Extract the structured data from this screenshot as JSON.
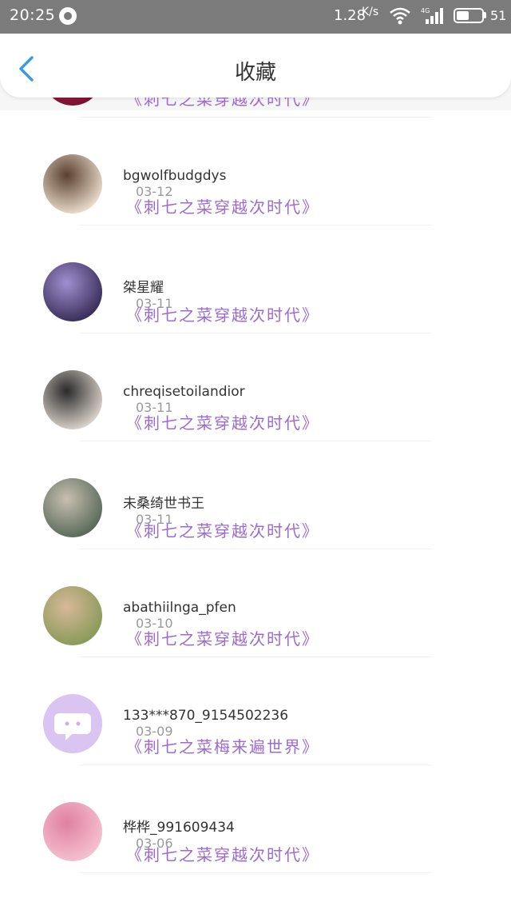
{
  "status_bar": {
    "time": "20:25",
    "speed": "1.28",
    "speed_unit": "K/s",
    "network": "4G",
    "battery": "51",
    "battery_level": 0.51
  },
  "header": {
    "title": "收藏"
  },
  "items": [
    {
      "username": "",
      "date": "",
      "book": "《刺七之菜穿越次时代》",
      "avatar_colors": [
        "#7a1030",
        "#c03060"
      ]
    },
    {
      "username": "bgwolfbudgdys",
      "date": "03-12",
      "book": "《刺七之菜穿越次时代》",
      "avatar_colors": [
        "#e8d9c8",
        "#5a4030"
      ]
    },
    {
      "username": "桀星耀",
      "date": "03-11",
      "book": "《刺七之菜穿越次时代》",
      "avatar_colors": [
        "#3a2e5a",
        "#a090d0"
      ]
    },
    {
      "username": "chreqisetoilandior",
      "date": "03-11",
      "book": "《刺七之菜穿越次时代》",
      "avatar_colors": [
        "#d8d0c8",
        "#2a2a2a"
      ]
    },
    {
      "username": "未桑绮世书王",
      "date": "03-11",
      "book": "《刺七之菜穿越次时代》",
      "avatar_colors": [
        "#5a6a5a",
        "#c8c0b0"
      ]
    },
    {
      "username": "abathiilnga_pfen",
      "date": "03-10",
      "book": "《刺七之菜穿越次时代》",
      "avatar_colors": [
        "#8a9a5a",
        "#d8b898"
      ]
    },
    {
      "username": "133***870_9154502236",
      "date": "03-09",
      "book": "《刺七之菜梅来遍世界》",
      "avatar_colors": [
        "#d9c4f2",
        "#ffffff"
      ]
    },
    {
      "username": "桦桦_991609434",
      "date": "03-06",
      "book": "《刺七之菜穿越次时代》",
      "avatar_colors": [
        "#f4c0d0",
        "#e080a0"
      ]
    }
  ]
}
